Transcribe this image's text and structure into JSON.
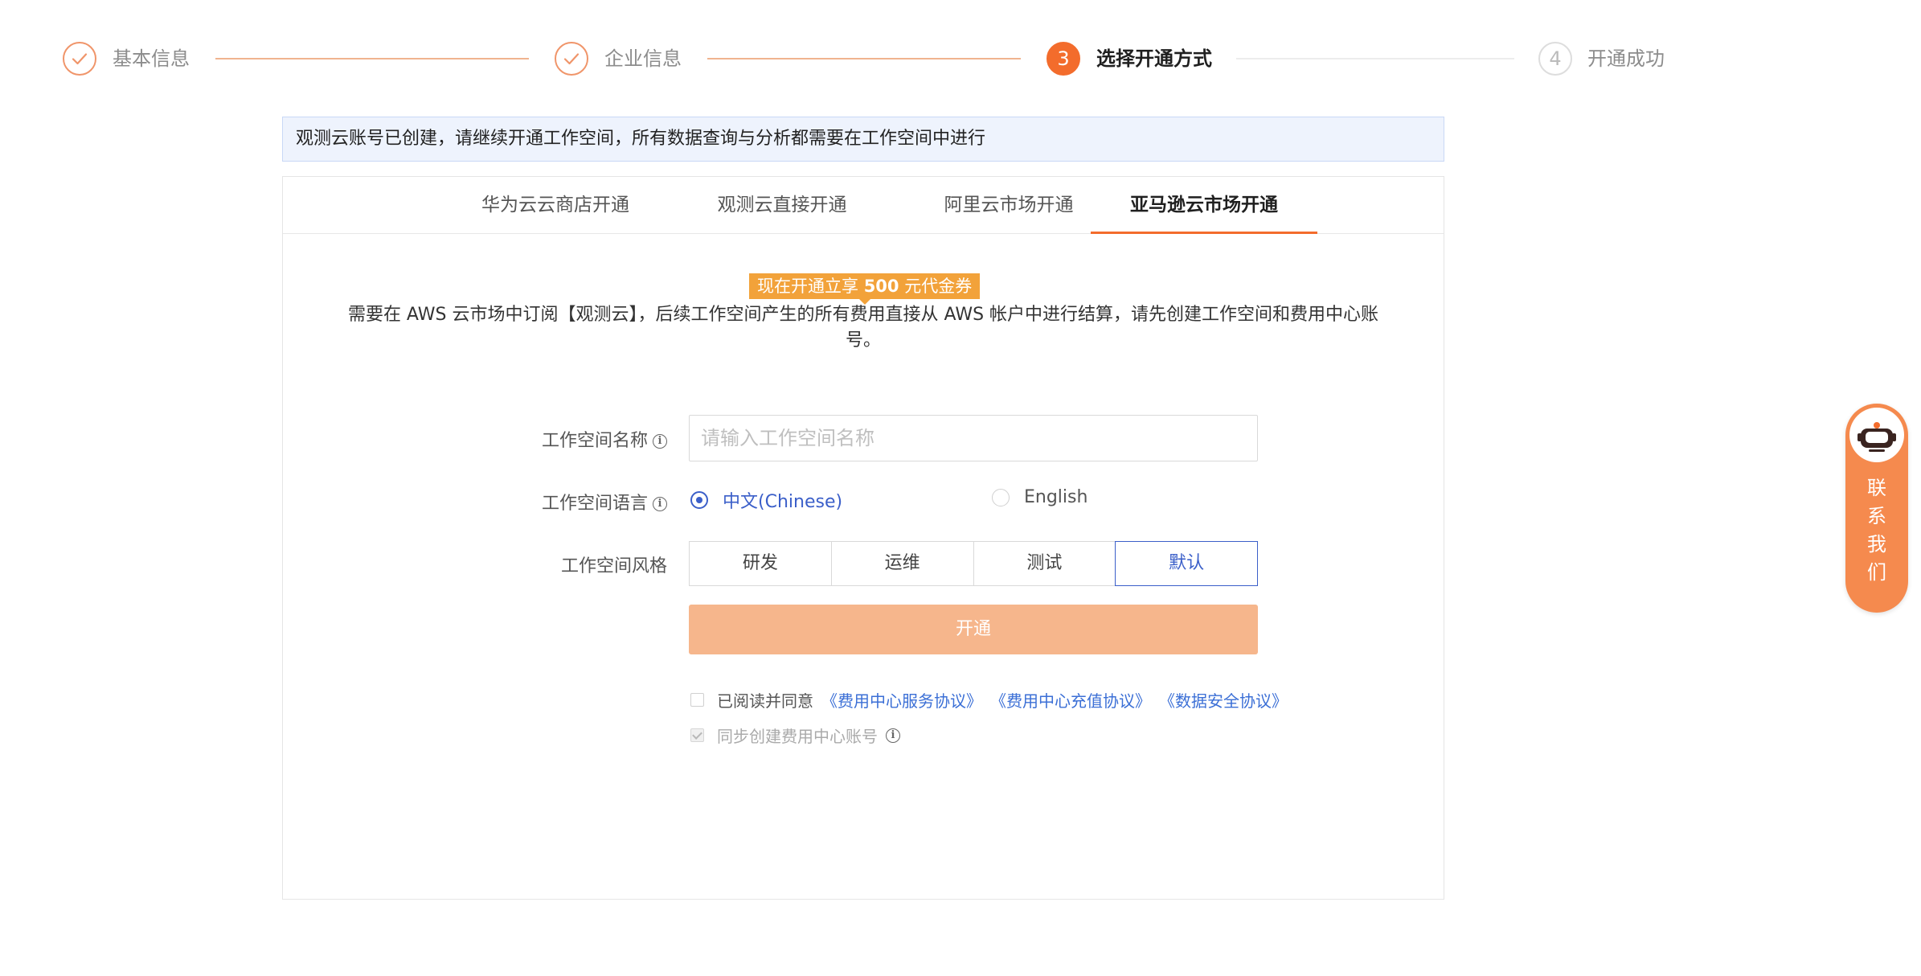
{
  "steps": [
    {
      "label": "基本信息",
      "status": "done"
    },
    {
      "label": "企业信息",
      "status": "done"
    },
    {
      "label": "选择开通方式",
      "number": "3",
      "status": "current"
    },
    {
      "label": "开通成功",
      "number": "4",
      "status": "todo"
    }
  ],
  "notice": "观测云账号已创建，请继续开通工作空间，所有数据查询与分析都需要在工作空间中进行",
  "tabs": [
    {
      "label": "华为云云商店开通"
    },
    {
      "label": "观测云直接开通"
    },
    {
      "label": "阿里云市场开通"
    },
    {
      "label": "亚马逊云市场开通",
      "active": true
    }
  ],
  "promo": {
    "prefix": "现在开通立享 ",
    "amount": "500",
    "suffix": " 元代金券"
  },
  "description": "需要在 AWS 云市场中订阅【观测云】，后续工作空间产生的所有费用直接从 AWS 帐户中进行结算，请先创建工作空间和费用中心账号。",
  "form": {
    "name_label": "工作空间名称",
    "name_placeholder": "请输入工作空间名称",
    "name_value": "",
    "language_label": "工作空间语言",
    "language_options": [
      {
        "label": "中文(Chinese)",
        "checked": true
      },
      {
        "label": "English",
        "checked": false
      }
    ],
    "style_label": "工作空间风格",
    "style_options": [
      {
        "label": "研发",
        "selected": false
      },
      {
        "label": "运维",
        "selected": false
      },
      {
        "label": "测试",
        "selected": false
      },
      {
        "label": "默认",
        "selected": true
      }
    ],
    "submit_label": "开通",
    "agree_text": "已阅读并同意",
    "agreements": [
      "《费用中心服务协议》",
      "《费用中心充值协议》",
      "《数据安全协议》"
    ],
    "sync_text": "同步创建费用中心账号"
  },
  "contact": {
    "label": "联系我们",
    "chars": [
      "联",
      "系",
      "我",
      "们"
    ]
  },
  "colors": {
    "accent": "#f36c2c",
    "primary": "#3b5fc9",
    "link": "#3b6fd6",
    "submit": "#f6b68c",
    "promo": "#f2a23a",
    "notice_bg": "#eef3fd"
  },
  "icons": {
    "done_step": "check-icon",
    "info": "info-icon",
    "contact": "service-robot-icon"
  }
}
